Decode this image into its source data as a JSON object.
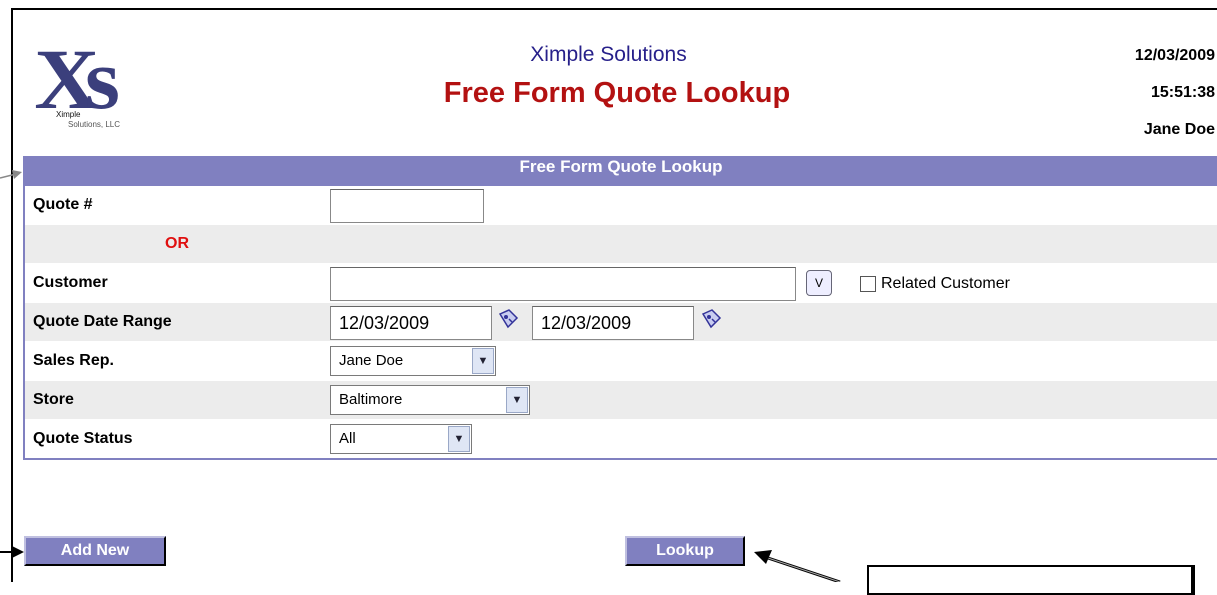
{
  "header": {
    "company": "Ximple Solutions",
    "title": "Free Form Quote Lookup",
    "date": "12/03/2009",
    "time": "15:51:38",
    "user": "Jane Doe",
    "logo_text": "Xs",
    "logo_sub1": "Ximple",
    "logo_sub2": "Solutions, LLC"
  },
  "form": {
    "heading": "Free Form Quote Lookup",
    "quote_label": "Quote #",
    "quote_value": "",
    "or_label": "OR",
    "customer_label": "Customer",
    "customer_value": "",
    "customer_button": "V",
    "related_customer_label": "Related Customer",
    "date_range_label": "Quote Date Range",
    "date_from": "12/03/2009",
    "date_to": "12/03/2009",
    "sales_rep_label": "Sales Rep.",
    "sales_rep_value": "Jane Doe",
    "store_label": "Store",
    "store_value": "Baltimore",
    "status_label": "Quote Status",
    "status_value": "All"
  },
  "buttons": {
    "add_new": "Add New",
    "lookup": "Lookup"
  },
  "colors": {
    "accent": "#8080c0",
    "title_red": "#b31111",
    "company_blue": "#27208a",
    "or_red": "#e01010"
  }
}
